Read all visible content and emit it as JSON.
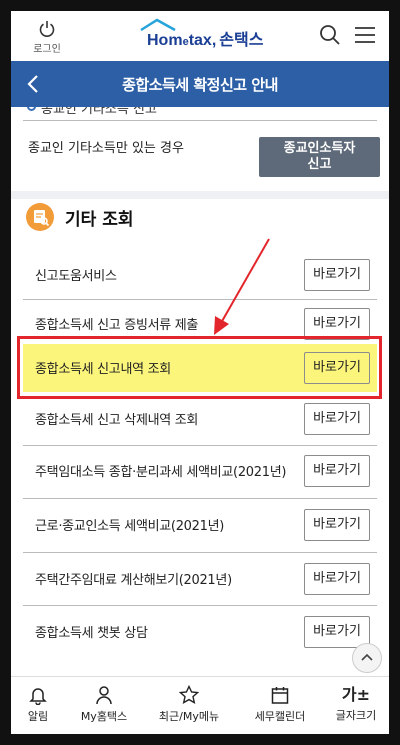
{
  "header": {
    "login_label": "로그인",
    "logo_home": "Hom",
    "logo_e": "e",
    "logo_tax": "tax,",
    "logo_son": "손택스"
  },
  "titlebar": {
    "title": "종합소득세 확정신고 안내"
  },
  "prev_section": {
    "heading_partial": "종교인 기타소득 신고",
    "description": "종교인 기타소득만 있는 경우",
    "button_line1": "종교인소득자",
    "button_line2": "신고"
  },
  "section": {
    "title": "기타 조회"
  },
  "rows": [
    {
      "label": "신고도움서비스",
      "button": "바로가기"
    },
    {
      "label": "종합소득세 신고 증빙서류 제출",
      "button": "바로가기"
    },
    {
      "label": "종합소득세 신고내역 조회",
      "button": "바로가기"
    },
    {
      "label": "종합소득세 신고 삭제내역 조회",
      "button": "바로가기"
    },
    {
      "label": "주택임대소득 종합·분리과세 세액비교(2021년)",
      "button": "바로가기"
    },
    {
      "label": "근로·종교인소득 세액비교(2021년)",
      "button": "바로가기"
    },
    {
      "label": "주택간주임대료 계산해보기(2021년)",
      "button": "바로가기"
    },
    {
      "label": "종합소득세 챗봇 상담",
      "button": "바로가기"
    }
  ],
  "bottom_nav": [
    {
      "label": "알림",
      "icon": "bell-icon"
    },
    {
      "label": "My홈택스",
      "icon": "person-icon"
    },
    {
      "label": "최근/My메뉴",
      "icon": "star-icon"
    },
    {
      "label": "세무캘린더",
      "icon": "calendar-icon"
    },
    {
      "label": "글자크기",
      "icon_text": "가±",
      "icon": "font-size-icon"
    }
  ],
  "colors": {
    "title_bar": "#2c5fa6",
    "highlight": "#fbf57c",
    "red_box": "#e3262b",
    "section_icon": "#f29c39"
  }
}
